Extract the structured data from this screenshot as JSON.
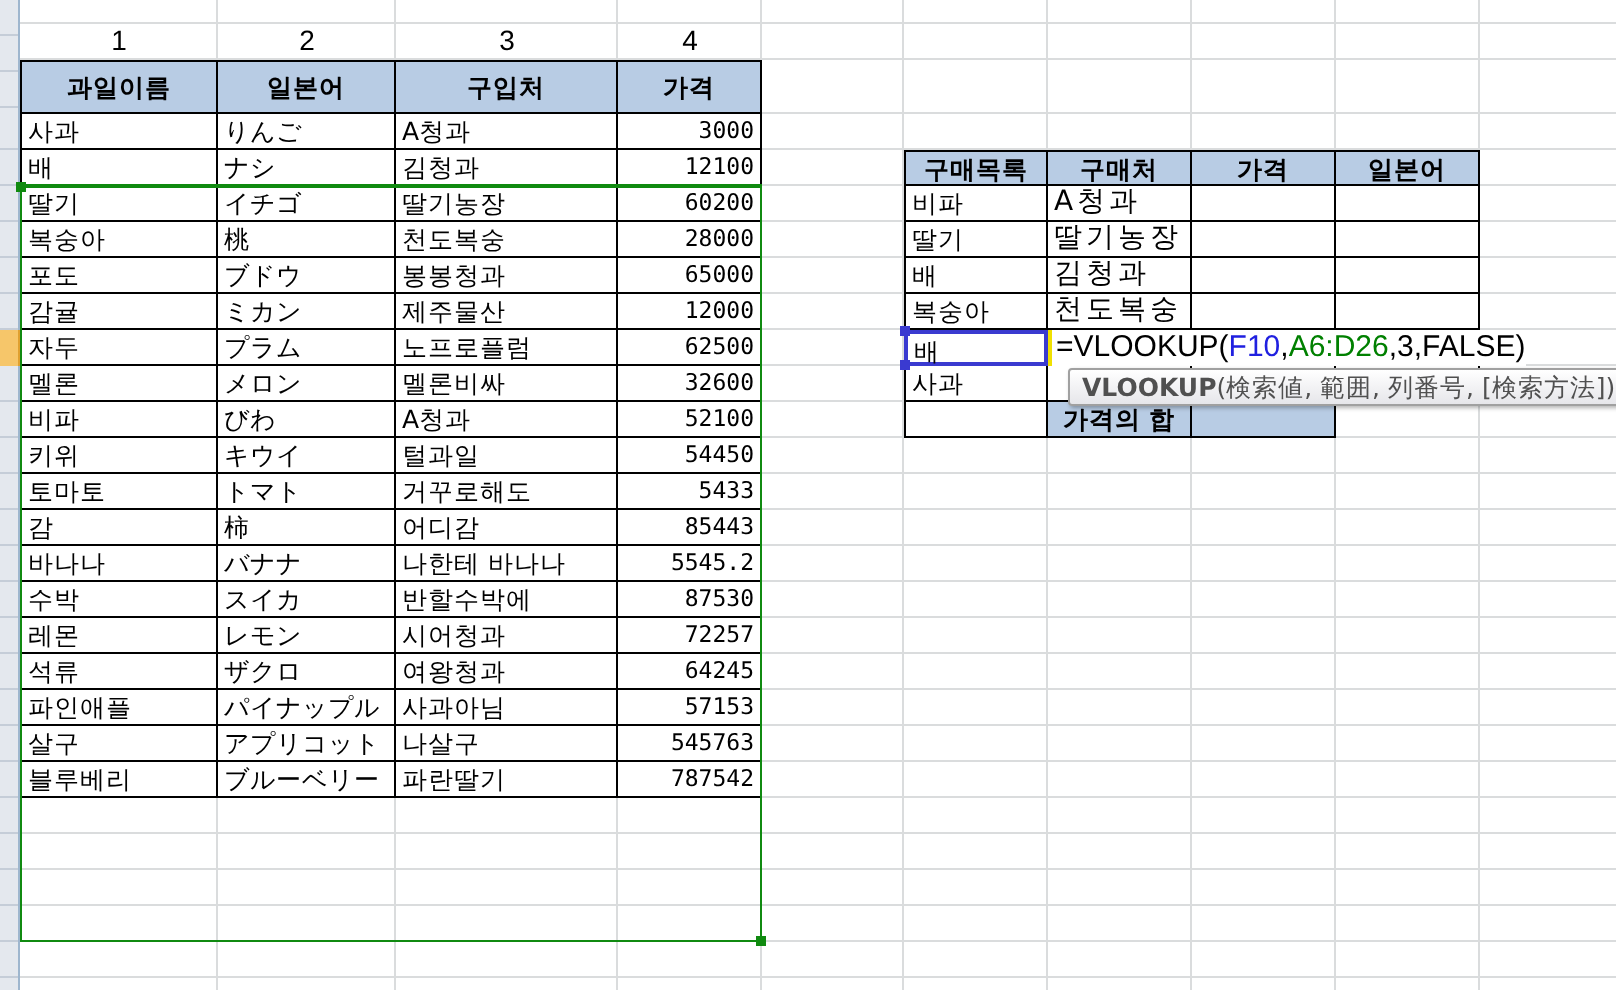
{
  "column_numbers": [
    "1",
    "2",
    "3",
    "4"
  ],
  "fruit_table": {
    "columns": [
      "과일이름",
      "일본어",
      "구입처",
      "가격"
    ],
    "rows": [
      [
        "사과",
        "りんご",
        "A청과",
        "3000"
      ],
      [
        "배",
        "ナシ",
        "김청과",
        "12100"
      ],
      [
        "딸기",
        "イチゴ",
        "딸기농장",
        "60200"
      ],
      [
        "복숭아",
        "桃",
        "천도복숭",
        "28000"
      ],
      [
        "포도",
        "ブドウ",
        "봉봉청과",
        "65000"
      ],
      [
        "감귤",
        "ミカン",
        "제주물산",
        "12000"
      ],
      [
        "자두",
        "プラム",
        "노프로플럼",
        "62500"
      ],
      [
        "멜론",
        "メロン",
        "멜론비싸",
        "32600"
      ],
      [
        "비파",
        "びわ",
        "A청과",
        "52100"
      ],
      [
        "키위",
        "キウイ",
        "털과일",
        "54450"
      ],
      [
        "토마토",
        "トマト",
        "거꾸로해도",
        "5433"
      ],
      [
        "감",
        "柿",
        "어디감",
        "85443"
      ],
      [
        "바나나",
        "バナナ",
        "나한테 바나나",
        "5545.2"
      ],
      [
        "수박",
        "スイカ",
        "반할수박에",
        "87530"
      ],
      [
        "레몬",
        "レモン",
        "시어청과",
        "72257"
      ],
      [
        "석류",
        "ザクロ",
        "여왕청과",
        "64245"
      ],
      [
        "파인애플",
        "パイナップル",
        "사과아님",
        "57153"
      ],
      [
        "살구",
        "アプリコット",
        "나살구",
        "545763"
      ],
      [
        "블루베리",
        "ブルーベリー",
        "파란딸기",
        "787542"
      ]
    ]
  },
  "purchase_table": {
    "columns": [
      "구매목록",
      "구매처",
      "가격",
      "일본어"
    ],
    "rows": [
      {
        "item": "비파",
        "vendor": "A청과",
        "selected": false
      },
      {
        "item": "딸기",
        "vendor": "딸기농장",
        "selected": false
      },
      {
        "item": "배",
        "vendor": "김청과",
        "selected": false
      },
      {
        "item": "복숭아",
        "vendor": "천도복숭",
        "selected": false
      },
      {
        "item": "배",
        "selected": true
      },
      {
        "item": "사과",
        "selected": false
      }
    ],
    "total_label": "가격의 합"
  },
  "formula": {
    "segments": [
      {
        "text": "=VLOOKUP(",
        "color": "#000000"
      },
      {
        "text": "F10",
        "color": "#2020e0"
      },
      {
        "text": ",",
        "color": "#000000"
      },
      {
        "text": "A6:D26",
        "color": "#008000"
      },
      {
        "text": ",3,FALSE)",
        "color": "#000000"
      }
    ]
  },
  "tooltip": "**VLOOKUP**(検索値, 範囲, 列番号, [検索方法])"
}
